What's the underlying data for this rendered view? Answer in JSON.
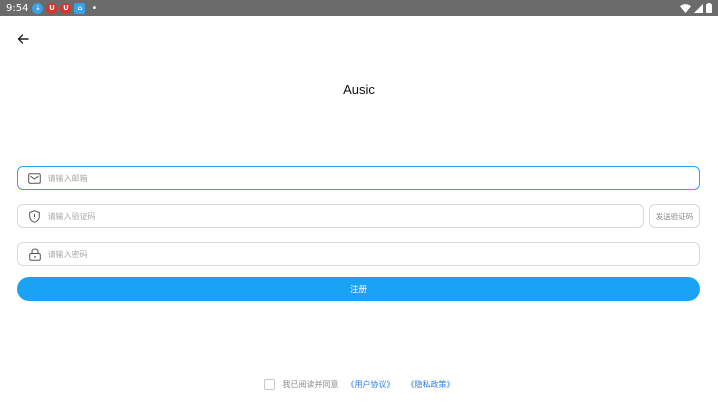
{
  "status_bar": {
    "time": "9:54",
    "app_icons": [
      {
        "name": "download",
        "color": "#3aa0e8",
        "glyph": "⇣"
      },
      {
        "name": "app-red-1",
        "color": "#d8342c",
        "glyph": "U"
      },
      {
        "name": "app-red-2",
        "color": "#d8342c",
        "glyph": "U"
      },
      {
        "name": "app-blue",
        "color": "#3aa0e8",
        "glyph": "⌂"
      }
    ],
    "dot": "•"
  },
  "header": {
    "title": "Ausic"
  },
  "form": {
    "email_placeholder": "请输入邮箱",
    "code_placeholder": "请输入验证码",
    "send_code_label": "发送验证码",
    "password_placeholder": "请输入密码",
    "register_label": "注册"
  },
  "agreement": {
    "text": "我已阅读并同意",
    "user_agreement": "《用户协议》",
    "privacy_policy": "《隐私政策》"
  },
  "colors": {
    "accent": "#1aa3f5",
    "link": "#2b7de0",
    "status_bar": "#6b6b6b"
  }
}
